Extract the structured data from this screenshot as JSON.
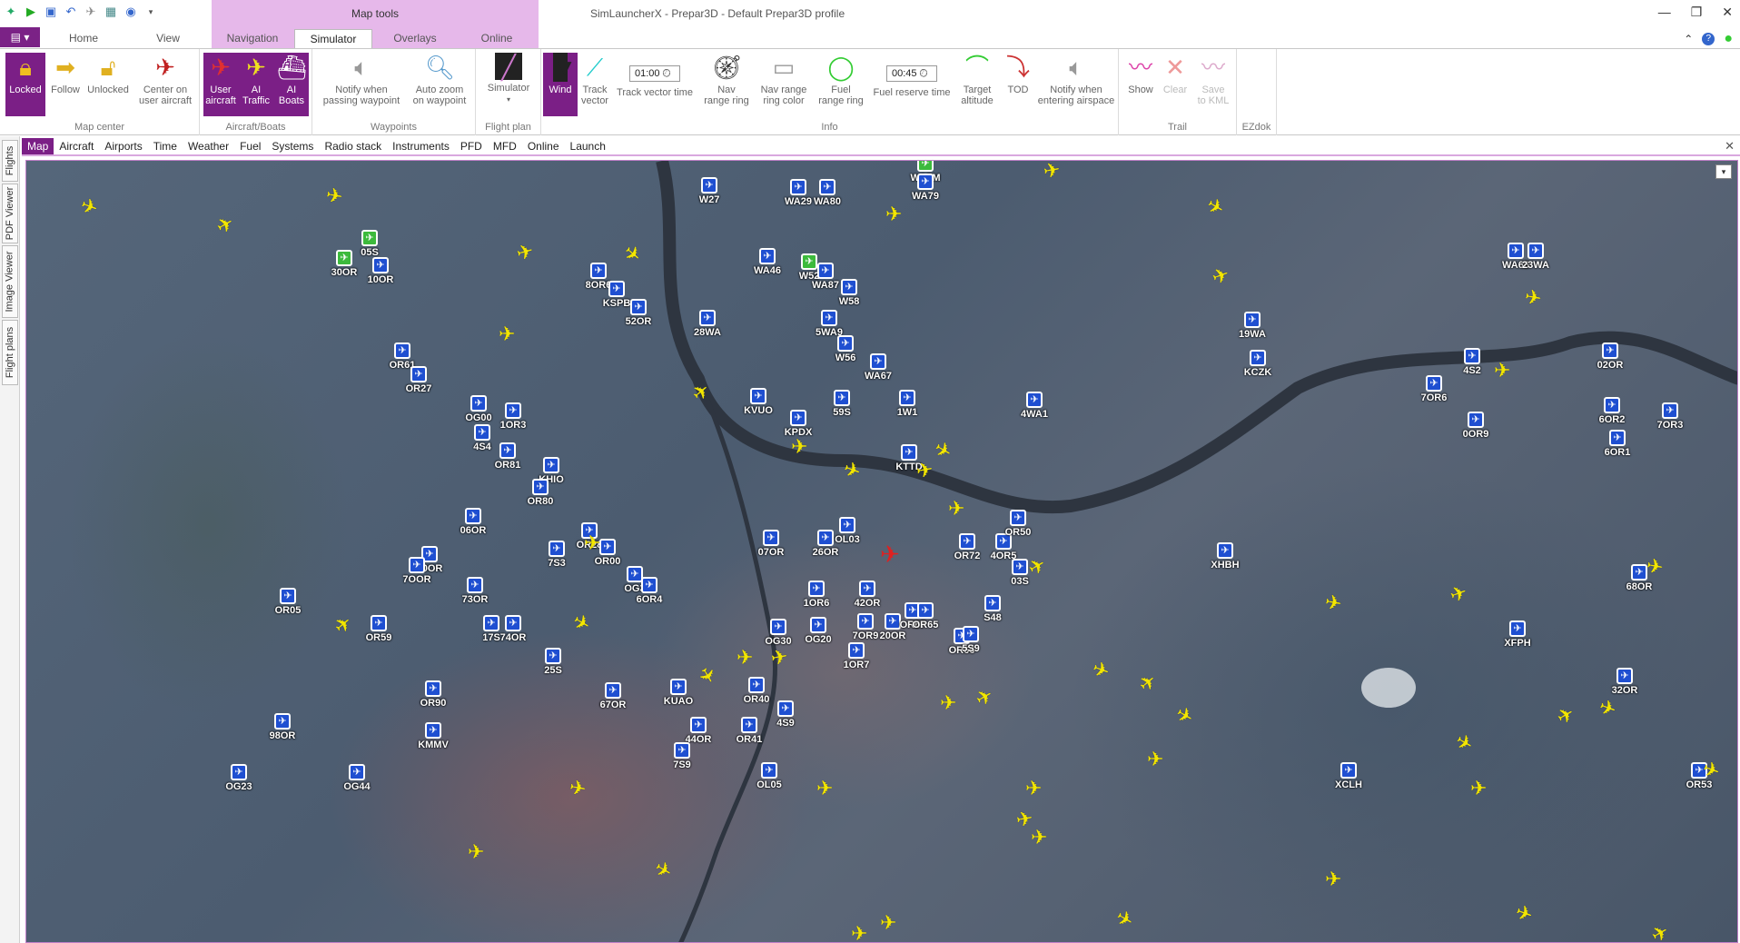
{
  "window": {
    "title": "SimLauncherX - Prepar3D - Default Prepar3D profile",
    "contextual_group": "Map tools"
  },
  "quick_access": {
    "icons": [
      "app-logo-icon",
      "run-icon",
      "save-icon",
      "undo-icon",
      "aircraft-icon",
      "flight-plan-icon",
      "radio-icon",
      "dropdown-icon"
    ]
  },
  "ribbon_tabs": {
    "home": "Home",
    "view": "View",
    "navigation": "Navigation",
    "simulator": "Simulator",
    "overlays": "Overlays",
    "online": "Online",
    "active": "Simulator"
  },
  "ribbon": {
    "map_center": {
      "label": "Map center",
      "locked": "Locked",
      "follow": "Follow",
      "unlocked": "Unlocked",
      "center": "Center on\nuser aircraft"
    },
    "aircraft_boats": {
      "label": "Aircraft/Boats",
      "user": "User\naircraft",
      "ai_traffic": "AI\nTraffic",
      "ai_boats": "AI\nBoats"
    },
    "waypoints": {
      "label": "Waypoints",
      "notify": "Notify when\npassing waypoint",
      "auto_zoom": "Auto zoom\non waypoint"
    },
    "flight_plan": {
      "label": "Flight plan",
      "simulator": "Simulator"
    },
    "info": {
      "label": "Info",
      "wind": "Wind",
      "track_vector": "Track\nvector",
      "track_vector_time_value": "01:00",
      "track_vector_time": "Track vector time",
      "nav_range": "Nav\nrange ring",
      "nav_range_color": "Nav range\nring color",
      "fuel_range": "Fuel\nrange ring",
      "fuel_reserve_value": "00:45",
      "fuel_reserve": "Fuel reserve time",
      "target_altitude": "Target\naltitude",
      "tod": "TOD",
      "notify_airspace": "Notify when\nentering airspace"
    },
    "trail": {
      "label": "Trail",
      "show": "Show",
      "clear": "Clear",
      "save": "Save\nto KML"
    },
    "ezdok": {
      "label": "EZdok"
    }
  },
  "side_tabs": [
    "Flights",
    "PDF Viewer",
    "Image Viewer",
    "Flight plans"
  ],
  "sub_tabs": [
    "Map",
    "Aircraft",
    "Airports",
    "Time",
    "Weather",
    "Fuel",
    "Systems",
    "Radio stack",
    "Instruments",
    "PFD",
    "MFD",
    "Online",
    "Launch"
  ],
  "active_sub_tab": "Map",
  "map": {
    "airports": [
      {
        "code": "WA7M",
        "green": true
      },
      {
        "code": "WA79",
        "green": false
      },
      {
        "code": "W27",
        "green": false
      },
      {
        "code": "WA29",
        "green": false
      },
      {
        "code": "WA80",
        "green": false
      },
      {
        "code": "05S",
        "green": true
      },
      {
        "code": "30OR",
        "green": true
      },
      {
        "code": "10OR",
        "green": false
      },
      {
        "code": "WA46",
        "green": false
      },
      {
        "code": "W52",
        "green": true
      },
      {
        "code": "WA87",
        "green": false
      },
      {
        "code": "8OR6",
        "green": false
      },
      {
        "code": "KSPB",
        "green": false
      },
      {
        "code": "W58",
        "green": false
      },
      {
        "code": "52OR",
        "green": false
      },
      {
        "code": "28WA",
        "green": false
      },
      {
        "code": "5WA9",
        "green": false
      },
      {
        "code": "W56",
        "green": false
      },
      {
        "code": "WA67",
        "green": false
      },
      {
        "code": "19WA",
        "green": false
      },
      {
        "code": "KCZK",
        "green": false
      },
      {
        "code": "WA66",
        "green": false
      },
      {
        "code": "23WA",
        "green": false
      },
      {
        "code": "OR61",
        "green": false
      },
      {
        "code": "OR27",
        "green": false
      },
      {
        "code": "KVUO",
        "green": false
      },
      {
        "code": "KPDX",
        "green": false
      },
      {
        "code": "59S",
        "green": false
      },
      {
        "code": "1W1",
        "green": false
      },
      {
        "code": "4WA1",
        "green": false
      },
      {
        "code": "4S2",
        "green": false
      },
      {
        "code": "02OR",
        "green": false
      },
      {
        "code": "7OR6",
        "green": false
      },
      {
        "code": "6OR2",
        "green": false
      },
      {
        "code": "7OR3",
        "green": false
      },
      {
        "code": "OG00",
        "green": false
      },
      {
        "code": "1OR3",
        "green": false
      },
      {
        "code": "4S4",
        "green": false
      },
      {
        "code": "OR81",
        "green": false
      },
      {
        "code": "KHIO",
        "green": false
      },
      {
        "code": "KTTD",
        "green": false
      },
      {
        "code": "0OR9",
        "green": false
      },
      {
        "code": "6OR1",
        "green": false
      },
      {
        "code": "OR80",
        "green": false
      },
      {
        "code": "06OR",
        "green": false
      },
      {
        "code": "OR28",
        "green": false
      },
      {
        "code": "OR00",
        "green": false
      },
      {
        "code": "OL03",
        "green": false
      },
      {
        "code": "26OR",
        "green": false
      },
      {
        "code": "OR72",
        "green": false
      },
      {
        "code": "4OR5",
        "green": false
      },
      {
        "code": "OR50",
        "green": false
      },
      {
        "code": "60OR",
        "green": false
      },
      {
        "code": "7OOR",
        "green": false
      },
      {
        "code": "7S3",
        "green": false
      },
      {
        "code": "07OR",
        "green": false
      },
      {
        "code": "03S",
        "green": false
      },
      {
        "code": "XHBH",
        "green": false
      },
      {
        "code": "OG3",
        "green": false
      },
      {
        "code": "6OR4",
        "green": false
      },
      {
        "code": "73OR",
        "green": false
      },
      {
        "code": "1OR6",
        "green": false
      },
      {
        "code": "42OR",
        "green": false
      },
      {
        "code": "S48",
        "green": false
      },
      {
        "code": "68OR",
        "green": false
      },
      {
        "code": "OR05",
        "green": false
      },
      {
        "code": "OR59",
        "green": false
      },
      {
        "code": "17S",
        "green": false
      },
      {
        "code": "74OR",
        "green": false
      },
      {
        "code": "OG30",
        "green": false
      },
      {
        "code": "OG20",
        "green": false
      },
      {
        "code": "7OR9",
        "green": false
      },
      {
        "code": "20OR",
        "green": false
      },
      {
        "code": "OR67",
        "green": false
      },
      {
        "code": "OR65",
        "green": false
      },
      {
        "code": "OR66",
        "green": false
      },
      {
        "code": "5S9",
        "green": false
      },
      {
        "code": "XFPH",
        "green": false
      },
      {
        "code": "25S",
        "green": false
      },
      {
        "code": "1OR7",
        "green": false
      },
      {
        "code": "OR90",
        "green": false
      },
      {
        "code": "67OR",
        "green": false
      },
      {
        "code": "KUAO",
        "green": false
      },
      {
        "code": "OR40",
        "green": false
      },
      {
        "code": "32OR",
        "green": false
      },
      {
        "code": "98OR",
        "green": false
      },
      {
        "code": "KMMV",
        "green": false
      },
      {
        "code": "44OR",
        "green": false
      },
      {
        "code": "OR41",
        "green": false
      },
      {
        "code": "4S9",
        "green": false
      },
      {
        "code": "7S9",
        "green": false
      },
      {
        "code": "OG23",
        "green": false
      },
      {
        "code": "OG44",
        "green": false
      },
      {
        "code": "OL05",
        "green": false
      },
      {
        "code": "XCLH",
        "green": false
      },
      {
        "code": "OR53",
        "green": false
      }
    ]
  },
  "colors": {
    "accent": "#7b1f86",
    "contextual_tab": "#e6b8ea",
    "airport": "#1f4fd1",
    "airport_private": "#3cba3c",
    "ai_traffic": "#f3e600",
    "user_aircraft": "#e02020"
  }
}
